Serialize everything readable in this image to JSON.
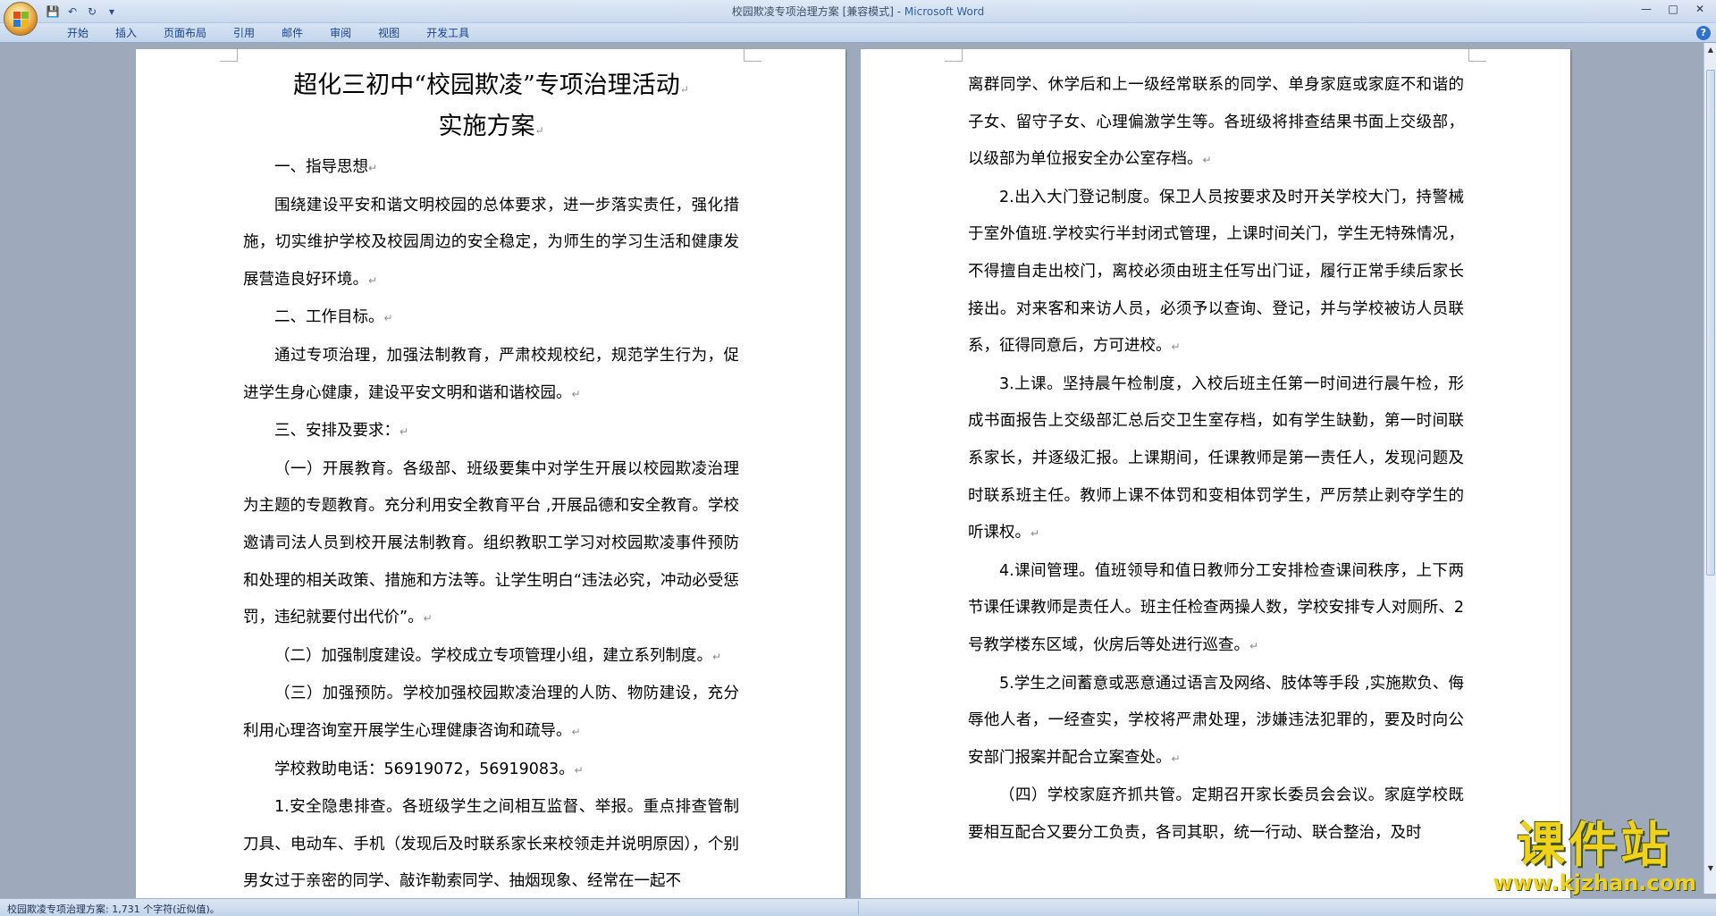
{
  "window": {
    "title_doc": "校园欺凌专项治理方案 [兼容模式] - ",
    "title_app": "Microsoft Word"
  },
  "ribbon": {
    "tabs": [
      "开始",
      "插入",
      "页面布局",
      "引用",
      "邮件",
      "审阅",
      "视图",
      "开发工具"
    ],
    "help": "?"
  },
  "left_page": {
    "title_line1": "超化三初中“校园欺凌”专项治理活动",
    "title_line2": "实施方案",
    "paragraphs": [
      {
        "text": "一、指导思想",
        "indent": true
      },
      {
        "text": "围绕建设平安和谐文明校园的总体要求，进一步落实责任，强化措施，切实维护学校及校园周边的安全稳定，为师生的学习生活和健康发展营造良好环境。",
        "indent": true
      },
      {
        "text": "二、工作目标。",
        "indent": true
      },
      {
        "text": "通过专项治理，加强法制教育，严肃校规校纪，规范学生行为，促进学生身心健康，建设平安文明和谐和谐校园。",
        "indent": true
      },
      {
        "text": "三、安排及要求：",
        "indent": true
      },
      {
        "text": "（一）开展教育。各级部、班级要集中对学生开展以校园欺凌治理为主题的专题教育。充分利用安全教育平台 ,开展品德和安全教育。学校邀请司法人员到校开展法制教育。组织教职工学习对校园欺凌事件预防和处理的相关政策、措施和方法等。让学生明白“违法必究，冲动必受惩罚，违纪就要付出代价”。",
        "indent": true
      },
      {
        "text": "（二）加强制度建设。学校成立专项管理小组，建立系列制度。",
        "indent": true
      },
      {
        "text": "（三）加强预防。学校加强校园欺凌治理的人防、物防建设，充分利用心理咨询室开展学生心理健康咨询和疏导。",
        "indent": true
      },
      {
        "text": "学校救助电话：56919072，56919083。",
        "indent": true
      },
      {
        "text": "1.安全隐患排查。各班级学生之间相互监督、举报。重点排查管制刀具、电动车、手机（发现后及时联系家长来校领走并说明原因），个别男女过于亲密的同学、敲诈勒索同学、抽烟现象、经常在一起不",
        "indent": true,
        "no_mark": true
      }
    ]
  },
  "right_page": {
    "paragraphs": [
      {
        "text": "离群同学、休学后和上一级经常联系的同学、单身家庭或家庭不和谐的子女、留守子女、心理偏激学生等。各班级将排查结果书面上交级部，以级部为单位报安全办公室存档。",
        "indent": false
      },
      {
        "text": "2.出入大门登记制度。保卫人员按要求及时开关学校大门，持警械于室外值班.学校实行半封闭式管理，上课时间关门，学生无特殊情况，不得擅自走出校门，离校必须由班主任写出门证，履行正常手续后家长接出。对来客和来访人员，必须予以查询、登记，并与学校被访人员联系，征得同意后，方可进校。",
        "indent": true
      },
      {
        "text": "3.上课。坚持晨午检制度，入校后班主任第一时间进行晨午检，形成书面报告上交级部汇总后交卫生室存档，如有学生缺勤，第一时间联系家长，并逐级汇报。上课期间，任课教师是第一责任人，发现问题及时联系班主任。教师上课不体罚和变相体罚学生，严厉禁止剥夺学生的听课权。",
        "indent": true
      },
      {
        "text": "4.课间管理。值班领导和值日教师分工安排检查课间秩序，上下两节课任课教师是责任人。班主任检查两操人数，学校安排专人对厕所、2 号教学楼东区域，伙房后等处进行巡查。",
        "indent": true
      },
      {
        "text": "5.学生之间蓄意或恶意通过语言及网络、肢体等手段 ,实施欺负、侮辱他人者，一经查实，学校将严肃处理，涉嫌违法犯罪的，要及时向公安部门报案并配合立案查处。",
        "indent": true
      },
      {
        "text": "（四）学校家庭齐抓共管。定期召开家长委员会会议。家庭学校既要相互配合又要分工负责，各司其职，统一行动、联合整治，及时",
        "indent": true,
        "no_mark": true
      }
    ]
  },
  "status": {
    "text": "校园欺凌专项治理方案: 1,731 个字符(近似值)。"
  },
  "watermark": {
    "line1": "课件站",
    "line2": "www.kjzhan.com"
  },
  "icons": {
    "paragraph_mark": "↵"
  },
  "colors": {
    "workspace": "#9eaabb",
    "ribbon_text": "#15428b",
    "watermark": "#f0d21b"
  }
}
